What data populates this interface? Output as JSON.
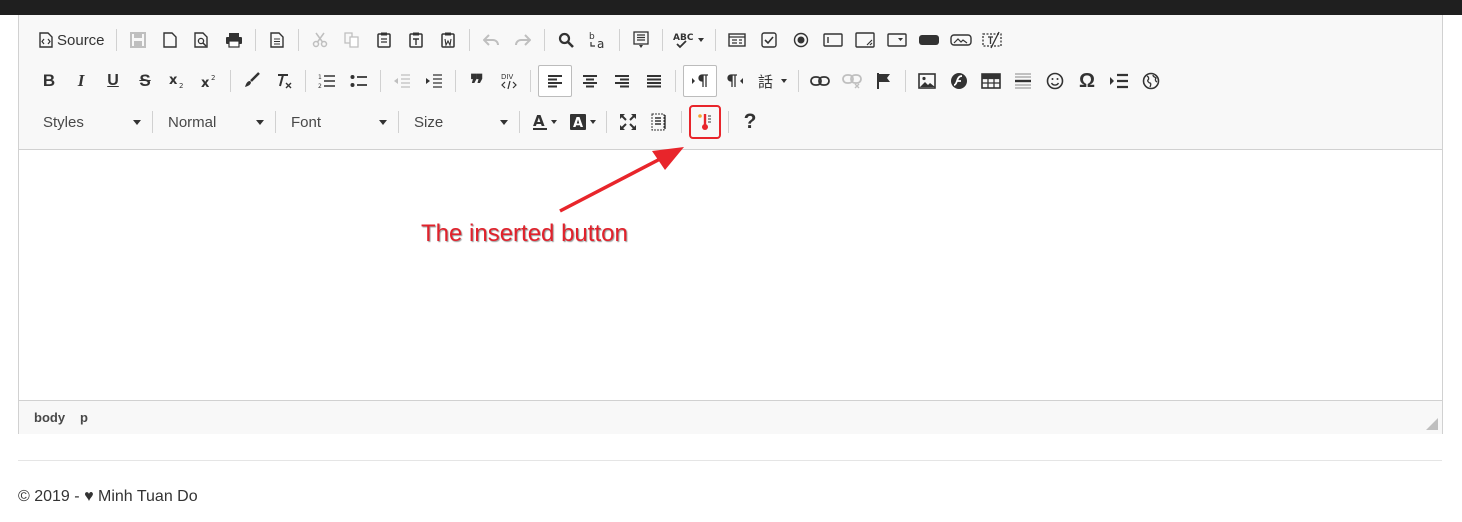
{
  "toolbar": {
    "source_label": "Source",
    "styles_label": "Styles",
    "format_label": "Normal",
    "font_label": "Font",
    "size_label": "Size",
    "help_label": "?"
  },
  "annotation": {
    "text": "The inserted button",
    "color": "#e1212b"
  },
  "elements_path": [
    "body",
    "p"
  ],
  "footer": {
    "copyright": "© 2019 -",
    "author": "Minh Tuan Do"
  },
  "colors": {
    "toolbar_bg": "#f8f8f8",
    "border": "#d1d1d1",
    "highlight": "#e8252b"
  }
}
